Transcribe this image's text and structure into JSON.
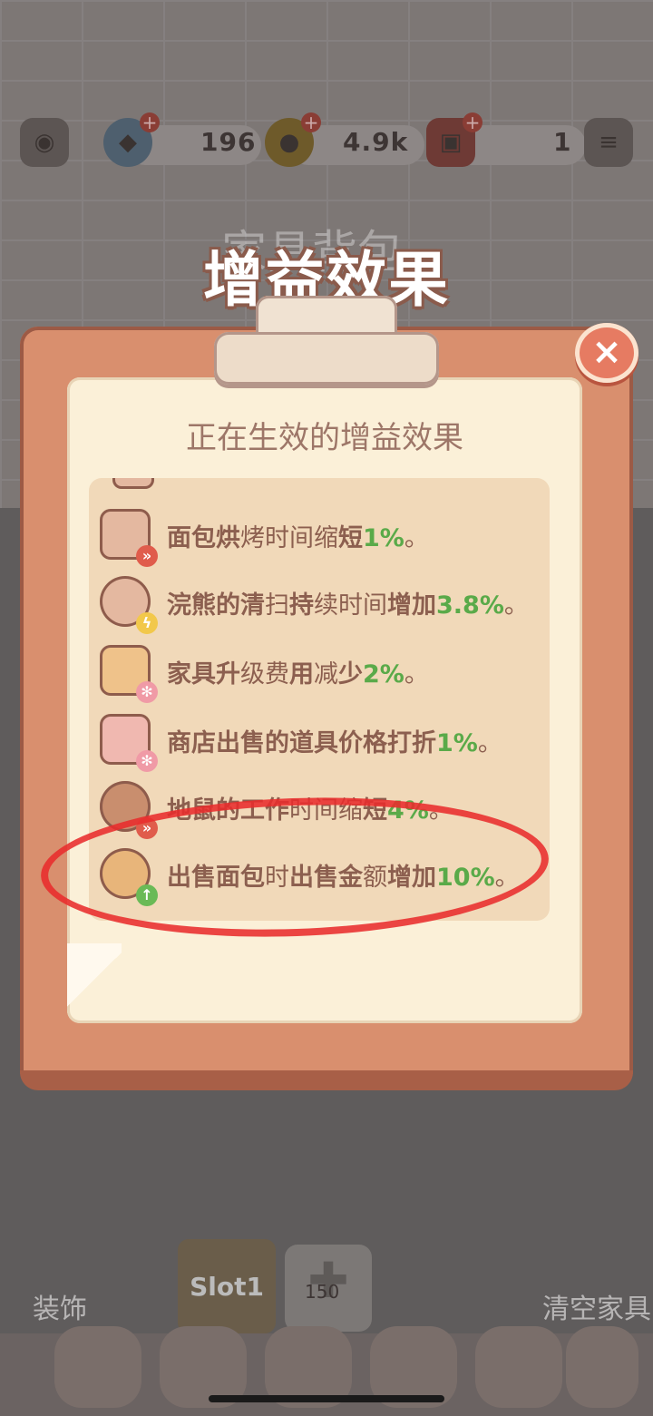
{
  "topbar": {
    "gem_count": "196",
    "coin_count": "4.9k",
    "ticket_count": "1",
    "icons": [
      "camera-icon",
      "gem-icon",
      "coin-icon",
      "ticket-icon",
      "notebook-icon"
    ]
  },
  "background": {
    "furniture_bag": "家具背包"
  },
  "popup": {
    "title": "增益效果",
    "subtitle": "正在生效的增益效果",
    "close": "×",
    "buffs": [
      {
        "icon": "oven-icon",
        "bold1": "面包烘",
        "light1": "烤时间缩",
        "bold2": "短",
        "value": "1%",
        "end": "。"
      },
      {
        "icon": "raccoon-icon",
        "bold1": "浣熊的清",
        "light1": "扫",
        "bold2": "持",
        "light2": "续时间",
        "bold3": "增加",
        "value": "3.8%",
        "end": "。"
      },
      {
        "icon": "cabinet-icon",
        "bold1": "家具升",
        "light1": "级费",
        "bold2": "用",
        "light2": "减",
        "bold3": "少",
        "value": "2%",
        "end": "。"
      },
      {
        "icon": "shop-icon",
        "bold1": "商店出售的道具价格打折",
        "value": "1%",
        "end": "。"
      },
      {
        "icon": "gopher-icon",
        "bold1": "地鼠的工作",
        "light1": "时间缩",
        "bold2": "短",
        "value": "4%",
        "end": "。"
      },
      {
        "icon": "bread-icon",
        "bold1": "出售面包",
        "light1": "时",
        "bold2": "出售金",
        "light2": "额",
        "bold3": "增加",
        "value": "10%",
        "end": "。"
      }
    ]
  },
  "bottom": {
    "decorate_label": "装饰",
    "slot_label": "Slot1",
    "add_slot_cost": "150",
    "clear_furniture_label": "清空家具"
  },
  "colors": {
    "board": "#d98f6e",
    "paper": "#fbf0d8",
    "list_bg": "#f1d9b9",
    "text_brown": "#8c5f4f",
    "value_green": "#5aaa49",
    "annotation_red": "#e82c2c"
  }
}
